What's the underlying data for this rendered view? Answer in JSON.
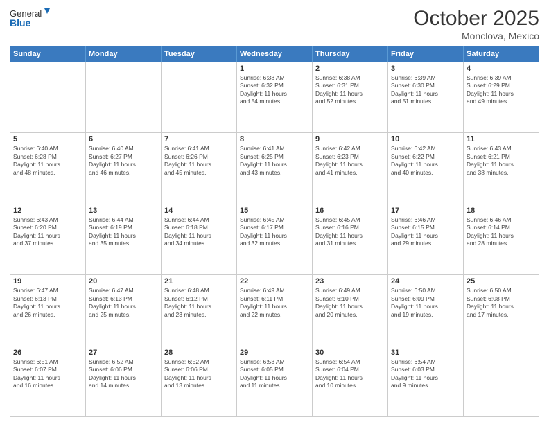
{
  "header": {
    "logo_line1": "General",
    "logo_line2": "Blue",
    "month": "October 2025",
    "location": "Monclova, Mexico"
  },
  "weekdays": [
    "Sunday",
    "Monday",
    "Tuesday",
    "Wednesday",
    "Thursday",
    "Friday",
    "Saturday"
  ],
  "weeks": [
    [
      {
        "day": "",
        "info": ""
      },
      {
        "day": "",
        "info": ""
      },
      {
        "day": "",
        "info": ""
      },
      {
        "day": "1",
        "info": "Sunrise: 6:38 AM\nSunset: 6:32 PM\nDaylight: 11 hours\nand 54 minutes."
      },
      {
        "day": "2",
        "info": "Sunrise: 6:38 AM\nSunset: 6:31 PM\nDaylight: 11 hours\nand 52 minutes."
      },
      {
        "day": "3",
        "info": "Sunrise: 6:39 AM\nSunset: 6:30 PM\nDaylight: 11 hours\nand 51 minutes."
      },
      {
        "day": "4",
        "info": "Sunrise: 6:39 AM\nSunset: 6:29 PM\nDaylight: 11 hours\nand 49 minutes."
      }
    ],
    [
      {
        "day": "5",
        "info": "Sunrise: 6:40 AM\nSunset: 6:28 PM\nDaylight: 11 hours\nand 48 minutes."
      },
      {
        "day": "6",
        "info": "Sunrise: 6:40 AM\nSunset: 6:27 PM\nDaylight: 11 hours\nand 46 minutes."
      },
      {
        "day": "7",
        "info": "Sunrise: 6:41 AM\nSunset: 6:26 PM\nDaylight: 11 hours\nand 45 minutes."
      },
      {
        "day": "8",
        "info": "Sunrise: 6:41 AM\nSunset: 6:25 PM\nDaylight: 11 hours\nand 43 minutes."
      },
      {
        "day": "9",
        "info": "Sunrise: 6:42 AM\nSunset: 6:23 PM\nDaylight: 11 hours\nand 41 minutes."
      },
      {
        "day": "10",
        "info": "Sunrise: 6:42 AM\nSunset: 6:22 PM\nDaylight: 11 hours\nand 40 minutes."
      },
      {
        "day": "11",
        "info": "Sunrise: 6:43 AM\nSunset: 6:21 PM\nDaylight: 11 hours\nand 38 minutes."
      }
    ],
    [
      {
        "day": "12",
        "info": "Sunrise: 6:43 AM\nSunset: 6:20 PM\nDaylight: 11 hours\nand 37 minutes."
      },
      {
        "day": "13",
        "info": "Sunrise: 6:44 AM\nSunset: 6:19 PM\nDaylight: 11 hours\nand 35 minutes."
      },
      {
        "day": "14",
        "info": "Sunrise: 6:44 AM\nSunset: 6:18 PM\nDaylight: 11 hours\nand 34 minutes."
      },
      {
        "day": "15",
        "info": "Sunrise: 6:45 AM\nSunset: 6:17 PM\nDaylight: 11 hours\nand 32 minutes."
      },
      {
        "day": "16",
        "info": "Sunrise: 6:45 AM\nSunset: 6:16 PM\nDaylight: 11 hours\nand 31 minutes."
      },
      {
        "day": "17",
        "info": "Sunrise: 6:46 AM\nSunset: 6:15 PM\nDaylight: 11 hours\nand 29 minutes."
      },
      {
        "day": "18",
        "info": "Sunrise: 6:46 AM\nSunset: 6:14 PM\nDaylight: 11 hours\nand 28 minutes."
      }
    ],
    [
      {
        "day": "19",
        "info": "Sunrise: 6:47 AM\nSunset: 6:13 PM\nDaylight: 11 hours\nand 26 minutes."
      },
      {
        "day": "20",
        "info": "Sunrise: 6:47 AM\nSunset: 6:13 PM\nDaylight: 11 hours\nand 25 minutes."
      },
      {
        "day": "21",
        "info": "Sunrise: 6:48 AM\nSunset: 6:12 PM\nDaylight: 11 hours\nand 23 minutes."
      },
      {
        "day": "22",
        "info": "Sunrise: 6:49 AM\nSunset: 6:11 PM\nDaylight: 11 hours\nand 22 minutes."
      },
      {
        "day": "23",
        "info": "Sunrise: 6:49 AM\nSunset: 6:10 PM\nDaylight: 11 hours\nand 20 minutes."
      },
      {
        "day": "24",
        "info": "Sunrise: 6:50 AM\nSunset: 6:09 PM\nDaylight: 11 hours\nand 19 minutes."
      },
      {
        "day": "25",
        "info": "Sunrise: 6:50 AM\nSunset: 6:08 PM\nDaylight: 11 hours\nand 17 minutes."
      }
    ],
    [
      {
        "day": "26",
        "info": "Sunrise: 6:51 AM\nSunset: 6:07 PM\nDaylight: 11 hours\nand 16 minutes."
      },
      {
        "day": "27",
        "info": "Sunrise: 6:52 AM\nSunset: 6:06 PM\nDaylight: 11 hours\nand 14 minutes."
      },
      {
        "day": "28",
        "info": "Sunrise: 6:52 AM\nSunset: 6:06 PM\nDaylight: 11 hours\nand 13 minutes."
      },
      {
        "day": "29",
        "info": "Sunrise: 6:53 AM\nSunset: 6:05 PM\nDaylight: 11 hours\nand 11 minutes."
      },
      {
        "day": "30",
        "info": "Sunrise: 6:54 AM\nSunset: 6:04 PM\nDaylight: 11 hours\nand 10 minutes."
      },
      {
        "day": "31",
        "info": "Sunrise: 6:54 AM\nSunset: 6:03 PM\nDaylight: 11 hours\nand 9 minutes."
      },
      {
        "day": "",
        "info": ""
      }
    ]
  ]
}
